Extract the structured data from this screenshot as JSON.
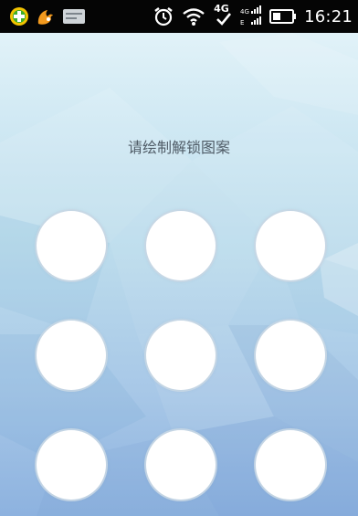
{
  "status_bar": {
    "time": "16:21",
    "network_label": "4G",
    "left_icons": [
      "360-security-icon",
      "uc-browser-icon",
      "notification-card-icon"
    ],
    "right_icons": [
      "alarm-icon",
      "wifi-icon",
      "4g-icon",
      "signal-icon",
      "battery-icon"
    ],
    "colors": {
      "background": "#050505",
      "text": "#ffffff"
    }
  },
  "lock_screen": {
    "prompt": "请绘制解锁图案",
    "pattern_grid": {
      "rows": 3,
      "cols": 3
    },
    "colors": {
      "dot_fill": "#ffffff",
      "prompt_text": "#4f5b66",
      "bg_top": "#e1f2f8",
      "bg_bottom": "#8db2df"
    }
  }
}
